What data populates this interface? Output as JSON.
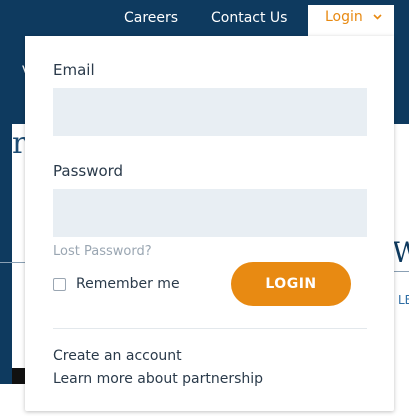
{
  "nav": {
    "careers": "Careers",
    "contact": "Contact Us",
    "login_tab": "Login"
  },
  "login_form": {
    "email_label": "Email",
    "email_value": "",
    "password_label": "Password",
    "password_value": "",
    "lost_password": "Lost Password?",
    "remember_me": "Remember me",
    "remember_checked": false,
    "login_button": "LOGIN",
    "create_account": "Create an account",
    "learn_more": "Learn more about partnership"
  },
  "colors": {
    "navy": "#0e3a5f",
    "accent_orange": "#e88a12",
    "input_bg": "#e8eef3"
  },
  "icons": {
    "login_chevron": "chevron-down-icon"
  }
}
